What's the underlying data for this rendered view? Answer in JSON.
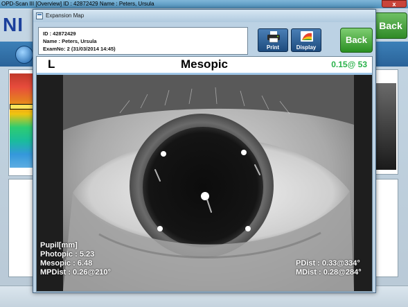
{
  "main_window": {
    "title": "OPD-Scan III  [Overview]  ID : 42872429  Name : Peters,  Ursula",
    "logo": "NI",
    "back_label": "Back",
    "close_label": "x"
  },
  "dialog": {
    "title": "Expansion Map",
    "patient": {
      "id_line": "ID : 42872429",
      "name_line": "Name : Peters,  Ursula",
      "exam_line": "ExamNo: 2 (31/03/2014 14:45)"
    },
    "buttons": {
      "print_label": "Print",
      "display_label": "Display",
      "back_label": "Back"
    }
  },
  "image_panel": {
    "eye": "L",
    "mode": "Mesopic",
    "accuracy": "0.15@ 53",
    "overlay": {
      "pupil_heading": "Pupil[mm]",
      "photopic": "Photopic : 5.23",
      "mesopic": "Mesopic : 6.48",
      "mpdist": "MPDist :  0.26@210°",
      "pdist": "PDist :  0.33@334°",
      "mdist": "MDist :  0.28@284°"
    }
  },
  "colors": {
    "accuracy_green": "#29b14a",
    "back_green": "#2a8f22",
    "tool_blue": "#1d4b7e",
    "dialog_bg": "#bcd2e4"
  }
}
